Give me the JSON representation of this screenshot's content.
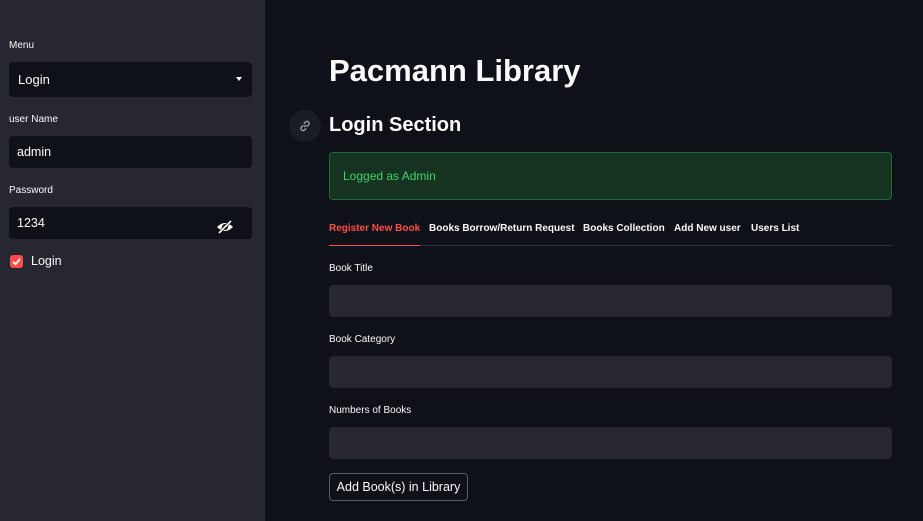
{
  "sidebar": {
    "menu_label": "Menu",
    "menu_value": "Login",
    "username_label": "user Name",
    "username_value": "admin",
    "password_label": "Password",
    "password_value": "1234",
    "login_checkbox_label": "Login",
    "login_checked": true
  },
  "main": {
    "title": "Pacmann Library",
    "section_title": "Login Section",
    "alert_text": "Logged as Admin",
    "tabs": [
      {
        "label": "Register New Book",
        "active": true
      },
      {
        "label": "Books Borrow/Return Request",
        "active": false
      },
      {
        "label": "Books Collection",
        "active": false
      },
      {
        "label": "Add New user",
        "active": false
      },
      {
        "label": "Users List",
        "active": false
      }
    ],
    "form": {
      "book_title_label": "Book Title",
      "book_title_value": "",
      "book_category_label": "Book Category",
      "book_category_value": "",
      "numbers_label": "Numbers of Books",
      "numbers_value": "",
      "submit_label": "Add Book(s) in Library"
    }
  },
  "colors": {
    "accent": "#ff4b4b",
    "sidebar_bg": "#262730",
    "main_bg": "#0e1117",
    "success_text": "#3ed36a",
    "success_bg": "#163322"
  },
  "icons": [
    "chevron-down-icon",
    "eye-slash-icon",
    "checkbox-checked-icon",
    "link-icon"
  ]
}
